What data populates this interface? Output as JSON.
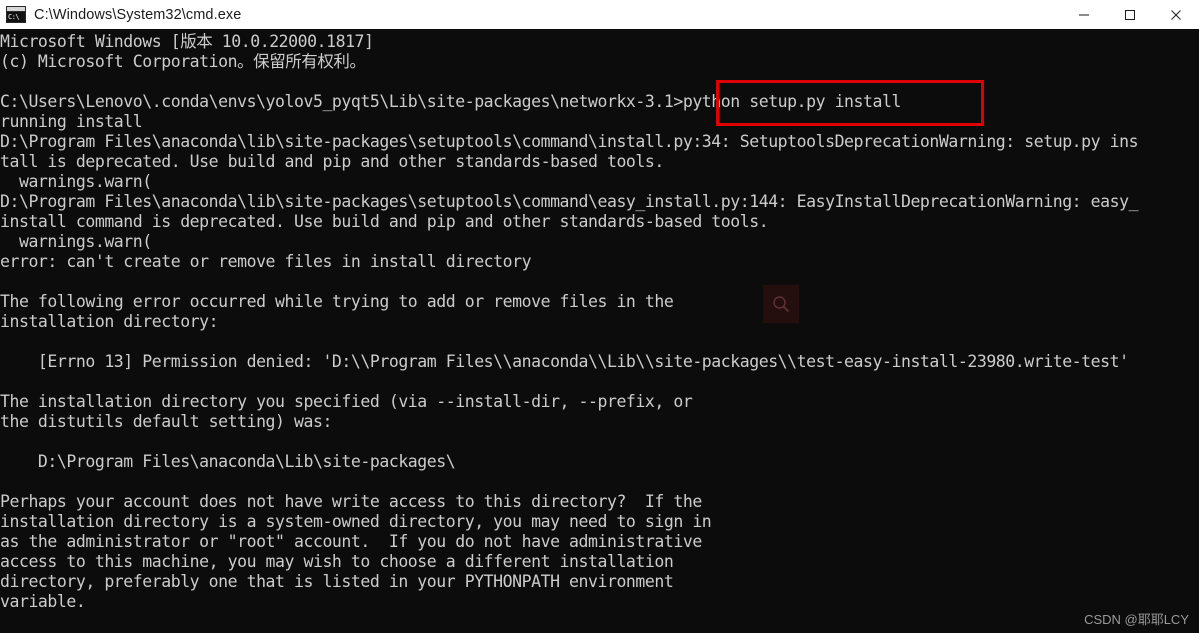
{
  "window": {
    "title": "C:\\Windows\\System32\\cmd.exe",
    "app_icon_name": "cmd-icon",
    "app_icon_text": "C:\\",
    "minimize_label": "Minimize",
    "maximize_label": "Maximize",
    "close_label": "Close",
    "titlebar_bg": "#ffffff",
    "titlebar_fg": "#1b1b1b"
  },
  "console": {
    "background": "#0c0c0c",
    "foreground": "#cccccc",
    "lines": [
      "Microsoft Windows [版本 10.0.22000.1817]",
      "(c) Microsoft Corporation。保留所有权利。",
      "",
      "C:\\Users\\Lenovo\\.conda\\envs\\yolov5_pyqt5\\Lib\\site-packages\\networkx-3.1>python setup.py install",
      "running install",
      "D:\\Program Files\\anaconda\\lib\\site-packages\\setuptools\\command\\install.py:34: SetuptoolsDeprecationWarning: setup.py ins",
      "tall is deprecated. Use build and pip and other standards-based tools.",
      "  warnings.warn(",
      "D:\\Program Files\\anaconda\\lib\\site-packages\\setuptools\\command\\easy_install.py:144: EasyInstallDeprecationWarning: easy_",
      "install command is deprecated. Use build and pip and other standards-based tools.",
      "  warnings.warn(",
      "error: can't create or remove files in install directory",
      "",
      "The following error occurred while trying to add or remove files in the",
      "installation directory:",
      "",
      "    [Errno 13] Permission denied: 'D:\\\\Program Files\\\\anaconda\\\\Lib\\\\site-packages\\\\test-easy-install-23980.write-test'",
      "",
      "The installation directory you specified (via --install-dir, --prefix, or",
      "the distutils default setting) was:",
      "",
      "    D:\\Program Files\\anaconda\\Lib\\site-packages\\",
      "",
      "Perhaps your account does not have write access to this directory?  If the",
      "installation directory is a system-owned directory, you may need to sign in",
      "as the administrator or \"root\" account.  If you do not have administrative",
      "access to this machine, you may wish to choose a different installation",
      "directory, preferably one that is listed in your PYTHONPATH environment",
      "variable."
    ]
  },
  "annotation": {
    "name": "red-highlight-box",
    "color": "#e00000",
    "highlighted_text": "python setup.py install"
  },
  "overlay": {
    "search_icon_name": "search-icon"
  },
  "watermark": {
    "text": "CSDN @耶耶LCY"
  }
}
